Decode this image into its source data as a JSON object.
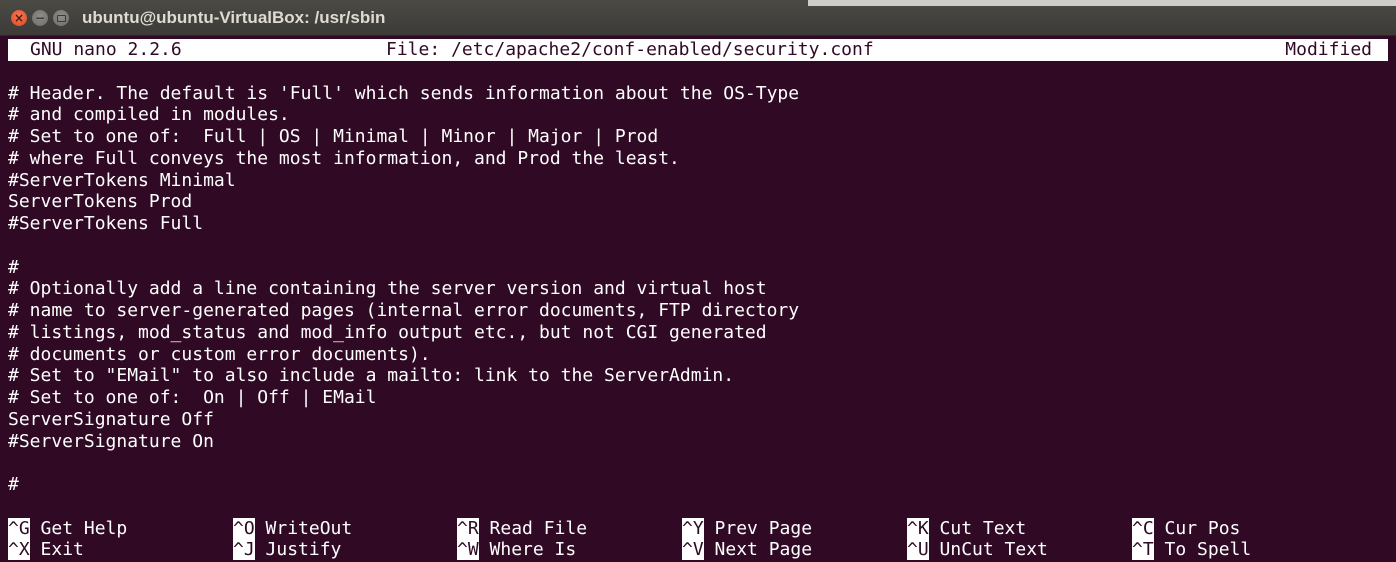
{
  "window": {
    "title": "ubuntu@ubuntu-VirtualBox: /usr/sbin",
    "close_glyph": "×",
    "minimize_glyph": "−"
  },
  "nano": {
    "version": "GNU nano 2.2.6",
    "file": "File: /etc/apache2/conf-enabled/security.conf",
    "status": "Modified"
  },
  "lines": [
    "",
    "# Header. The default is 'Full' which sends information about the OS-Type",
    "# and compiled in modules.",
    "# Set to one of:  Full | OS | Minimal | Minor | Major | Prod",
    "# where Full conveys the most information, and Prod the least.",
    "#ServerTokens Minimal",
    "ServerTokens Prod",
    "#ServerTokens Full",
    "",
    "#",
    "# Optionally add a line containing the server version and virtual host",
    "# name to server-generated pages (internal error documents, FTP directory",
    "# listings, mod_status and mod_info output etc., but not CGI generated",
    "# documents or custom error documents).",
    "# Set to \"EMail\" to also include a mailto: link to the ServerAdmin.",
    "# Set to one of:  On | Off | EMail",
    "ServerSignature Off",
    "#ServerSignature On",
    "",
    "#",
    ""
  ],
  "shortcuts": [
    [
      {
        "key": "^G",
        "label": "Get Help"
      },
      {
        "key": "^O",
        "label": "WriteOut"
      },
      {
        "key": "^R",
        "label": "Read File"
      },
      {
        "key": "^Y",
        "label": "Prev Page"
      },
      {
        "key": "^K",
        "label": "Cut Text"
      },
      {
        "key": "^C",
        "label": "Cur Pos"
      }
    ],
    [
      {
        "key": "^X",
        "label": "Exit"
      },
      {
        "key": "^J",
        "label": "Justify"
      },
      {
        "key": "^W",
        "label": "Where Is"
      },
      {
        "key": "^V",
        "label": "Next Page"
      },
      {
        "key": "^U",
        "label": "UnCut Text"
      },
      {
        "key": "^T",
        "label": "To Spell"
      }
    ]
  ],
  "colors": {
    "terminal_bg": "#300a24",
    "text": "#ffffff",
    "titlebar": "#3c3b37",
    "close_button": "#e1451b"
  }
}
